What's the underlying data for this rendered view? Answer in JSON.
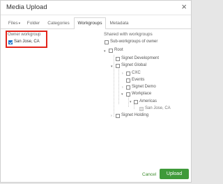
{
  "dialog": {
    "title": "Media Upload",
    "close_glyph": "×"
  },
  "tabs": [
    {
      "label": "Files",
      "caret": "▾"
    },
    {
      "label": "Folder"
    },
    {
      "label": "Categories"
    },
    {
      "label": "Workgroups"
    },
    {
      "label": "Metadata"
    }
  ],
  "owner": {
    "heading": "Owner workgroup",
    "value": "San Jose, CA",
    "checked": true
  },
  "shared": {
    "heading": "Shared with workgroups",
    "sub_label": "Sub-workgroups of owner",
    "tree": [
      {
        "label": "Root",
        "arrow": "▾"
      },
      {
        "label": "Signet Development"
      },
      {
        "label": "Signet Global",
        "arrow": "▾"
      },
      {
        "label": "CXC",
        "arrow": "›"
      },
      {
        "label": "Events"
      },
      {
        "label": "Signet Demo",
        "arrow": "›"
      },
      {
        "label": "Workplace",
        "arrow": "▾"
      },
      {
        "label": "Americas",
        "arrow": "▾"
      },
      {
        "label": "San Jose, CA"
      },
      {
        "label": "Signet Holding",
        "arrow": "›"
      }
    ]
  },
  "footer": {
    "cancel_label": "Cancel",
    "upload_label": "Upload"
  },
  "colors": {
    "accent_green": "#3f9a3a",
    "highlight_red": "#e2231a",
    "checkbox_blue": "#1a73c9"
  }
}
